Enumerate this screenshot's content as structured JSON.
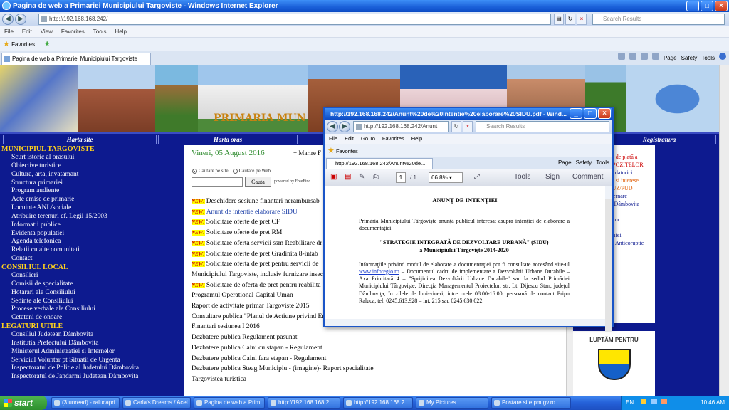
{
  "window": {
    "title": "Pagina de web a Primariei Municipiului Targoviste - Windows Internet Explorer"
  },
  "browser": {
    "address": "http://192.168.168.242/",
    "search_placeholder": "Search Results",
    "menu": [
      "File",
      "Edit",
      "View",
      "Favorites",
      "Tools",
      "Help"
    ],
    "favorites_label": "Favorites",
    "tab_label": "Pagina de web a Primariei Municipiului Targoviste",
    "cmd": {
      "page": "Page",
      "safety": "Safety",
      "tools": "Tools"
    }
  },
  "site": {
    "banner_caption": "PRIMARIA MUN",
    "topnav": [
      "Harta site",
      "Harta oras",
      "Registratura"
    ],
    "left_menu": {
      "sections": [
        {
          "title": "MUNICIPIUL TARGOVISTE",
          "items": [
            "Scurt istoric al orasului",
            "Obiective turistice",
            "Cultura, arta, invatamant",
            "Structura primariei",
            "Program audiente",
            "Acte emise de primarie",
            "Locuinte ANL/sociale",
            "Atribuire terenuri cf. Legii 15/2003",
            "Informatii publice",
            "Evidenta populatiei",
            "Agenda telefonica",
            "Relatii cu alte comunitati",
            "Contact"
          ]
        },
        {
          "title": "CONSILIUL LOCAL",
          "items": [
            "Consilieri",
            "Comisii de specialitate",
            "Hotarari ale Consiliului",
            "Sedinte ale Consiliului",
            "Procese verbale ale Consiliului",
            "Cetateni de onoare"
          ]
        },
        {
          "title": "LEGATURI UTILE",
          "items": [
            "Consiliul Judetean Dâmbovita",
            "Institutia Prefectului Dâmbovita",
            "Ministerul Administratiei si Internelor",
            "Serviciul Voluntar pt Situatii de Urgenta",
            "Inspectoratul de Politie al Judetului Dâmbovita",
            "Inspectoratul de Jandarmi Judetean Dâmbovita"
          ]
        }
      ]
    },
    "date": "Vineri, 05 August 2016",
    "marire": "+ Marire F",
    "search": {
      "opt1": "Cautare pe site",
      "opt2": "Cautare pe Web",
      "button": "Cauta",
      "powered": "powered by FreeFind"
    },
    "new_badge": "NEW!",
    "news": [
      {
        "new": true,
        "link": false,
        "text": "Deschidere sesiune finantari nerambursab"
      },
      {
        "new": true,
        "link": true,
        "text": "Anunt de intentie elaborare SIDU"
      },
      {
        "new": true,
        "link": false,
        "text": "Solicitare oferte de pret CF"
      },
      {
        "new": true,
        "link": false,
        "text": "Solicitare oferte de pret RM"
      },
      {
        "new": true,
        "link": false,
        "text": "Solicitare oferta servicii ssm Reabilitare dr"
      },
      {
        "new": true,
        "link": false,
        "text": "Solicitare oferte de pret Gradinita 8-intab"
      },
      {
        "new": true,
        "link": false,
        "text": "Solicitare oferta de pret pentru servicii de"
      },
      {
        "new": false,
        "link": false,
        "text": "Municipiului Targoviste, inclusiv furnizare insecti"
      },
      {
        "new": true,
        "link": false,
        "text": "Solicitare de oferta de pret pentru reabilita"
      },
      {
        "new": false,
        "link": false,
        "text": "Programul Operational Capital Uman"
      },
      {
        "new": false,
        "link": false,
        "text": "Raport de activitate primar Targoviste 2015"
      },
      {
        "new": false,
        "link": false,
        "text": "Consultare publica \"Planul de Actiune privind En"
      },
      {
        "new": false,
        "link": false,
        "text": "Finantari sesiunea I 2016"
      },
      {
        "new": false,
        "link": false,
        "text": "Dezbatere publica Regulament pasunat"
      },
      {
        "new": false,
        "link": false,
        "text": "Dezbatere publica Caini cu stapan - Regulament"
      },
      {
        "new": false,
        "link": false,
        "text": "Dezbatere publica Caini fara stapan - Regulament"
      },
      {
        "new": false,
        "link": false,
        "text": "Dezbatere publica Steag Municipiu - (imagine)-  Raport specialitate"
      },
      {
        "new": false,
        "link": false,
        "text": "Targovistea turistica"
      }
    ],
    "right": {
      "items": [
        "as",
        "nic de plată a",
        "MPOZITELOR",
        "lor datorici",
        "",
        "ere si interese",
        "/PUZ/PUD",
        "",
        "uvernare",
        "an Dâmbovita",
        "nic",
        "ntilor",
        "iei",
        "naniei",
        "ala Anticoruptie"
      ],
      "luptam": "LUPTĂM PENTRU"
    }
  },
  "pdf": {
    "title": "http://192.168.168.242/Anunt%20de%20Intentie%20elaborare%20SIDU.pdf - Wind...",
    "address": "http://192.168.168.242/Anunt",
    "search_placeholder": "Search Results",
    "menu": [
      "File",
      "Edit",
      "Go To",
      "Favorites",
      "Help"
    ],
    "favorites_label": "Favorites",
    "tab_label": "http://192.168.168.242/Anunt%20de...",
    "cmd": {
      "page": "Page",
      "safety": "Safety",
      "tools": "Tools"
    },
    "page": "1",
    "pages": "/ 1",
    "zoom": "66.8%",
    "btn_tools": "Tools",
    "btn_sign": "Sign",
    "btn_comment": "Comment",
    "doc": {
      "heading": "ANUNŢ DE INTENŢIEI",
      "p1": "Primăria Municipiului Târgovişte anunţă publicul interesat asupra intenţiei de elaborare a documentaţiei:",
      "strategy": "\"STRATEGIE INTEGRATĂ DE DEZVOLTARE URBANĂ\" (SIDU)",
      "strategy_sub": "a Municipiului Târgovişte 2014-2020",
      "p2_pre": "Informaţiile privind modul de elaborare a documentaţiei pot fi consultate accesând site-ul",
      "p2_link": "www.inforegio.ro",
      "p2_post": "– Documentul cadru de implementare a Dezvoltării Urbane Durabile – Axa Prioritară 4 – \"Sprijinirea Dezvoltării Urbane Durabile\" sau la sediul Primăriei Municipiului Târgovişte, Direcţia Managementul Proiectelor, str. Lt. Dijescu Stan, judeţul Dâmboviţa, în zilele de luni-vineri, intre orele 08.00-16.00, persoană de contact Pripu Raluca, tel. 0245.613.928 – int. 215 sau 0245.630.022."
    }
  },
  "taskbar": {
    "start": "start",
    "buttons": [
      "(3 unread) - ralucapri...",
      "Carla's Dreams / Acel...",
      "Pagina de web a Prim...",
      "http://192.168.168.2...",
      "http://192.168.168.2...",
      "My Pictures",
      "Postare site pmtgv.ro..."
    ],
    "lang": "EN",
    "clock": "10:46 AM"
  }
}
